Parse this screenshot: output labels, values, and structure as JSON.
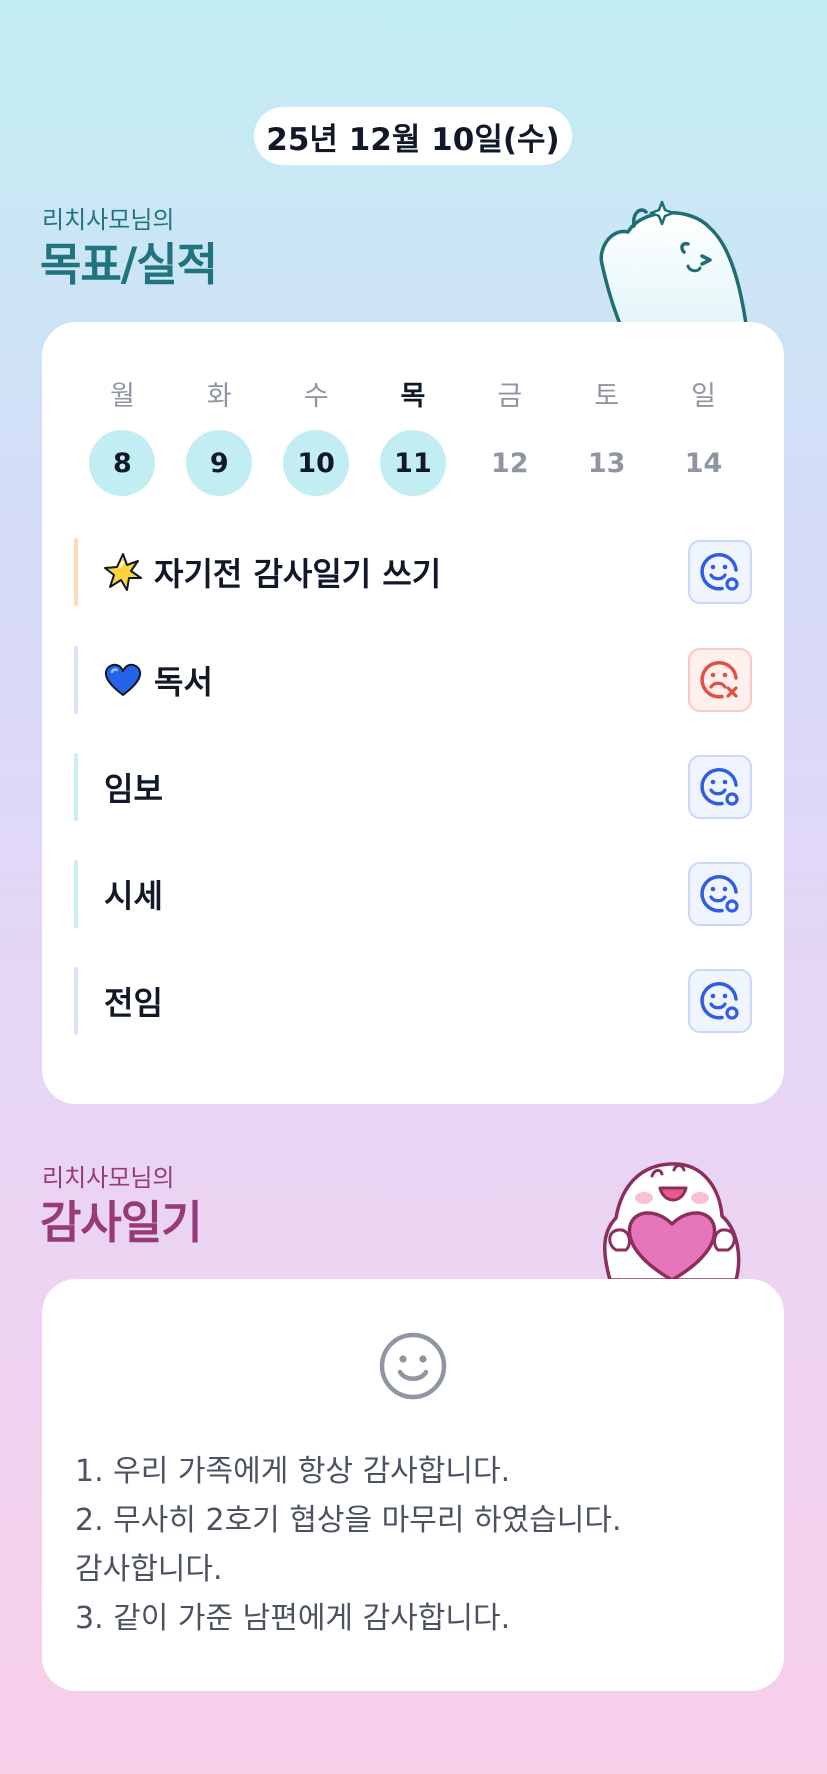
{
  "header": {
    "date": "25년 12월 10일(수)"
  },
  "goals_section": {
    "owner": "리치사모님의",
    "title": "목표/실적",
    "weekdays": [
      {
        "label": "월",
        "today": false
      },
      {
        "label": "화",
        "today": false
      },
      {
        "label": "수",
        "today": false
      },
      {
        "label": "목",
        "today": true
      },
      {
        "label": "금",
        "today": false
      },
      {
        "label": "토",
        "today": false
      },
      {
        "label": "일",
        "today": false
      }
    ],
    "dates": [
      {
        "num": "8",
        "filled": true
      },
      {
        "num": "9",
        "filled": true
      },
      {
        "num": "10",
        "filled": true
      },
      {
        "num": "11",
        "filled": true
      },
      {
        "num": "12",
        "filled": false
      },
      {
        "num": "13",
        "filled": false
      },
      {
        "num": "14",
        "filled": false
      }
    ],
    "items": [
      {
        "label": "자기전 감사일기 쓰기",
        "emoji": "sparkle-star-icon",
        "bar_color": "#fcdcb4",
        "status": "done"
      },
      {
        "label": "독서",
        "emoji": "blue-heart-icon",
        "bar_color": "#d9e3fb",
        "status": "failed"
      },
      {
        "label": "임보",
        "emoji": "",
        "bar_color": "#cdeff4",
        "status": "done"
      },
      {
        "label": "시세",
        "emoji": "",
        "bar_color": "#cdeff4",
        "status": "done"
      },
      {
        "label": "전임",
        "emoji": "",
        "bar_color": "#d9e3fb",
        "status": "done"
      }
    ]
  },
  "diary_section": {
    "owner": "리치사모님의",
    "title": "감사일기",
    "face_icon": "smile-face-icon",
    "lines": [
      "1. 우리 가족에게 항상 감사합니다.",
      "2. 무사히 2호기 협상을 마무리 하였습니다.",
      "감사합니다.",
      "3. 같이 가준 남편에게 감사합니다."
    ]
  },
  "colors": {
    "teal_title": "#1f7480",
    "plum_title": "#963a78",
    "date_highlight": "#c2eef3",
    "ok_icon": "#2f5fe0",
    "fail_icon": "#e0513f"
  }
}
